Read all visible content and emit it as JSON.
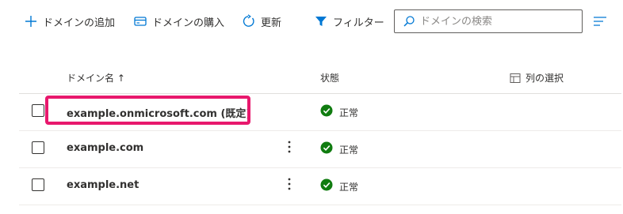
{
  "toolbar": {
    "add_domain": "ドメインの追加",
    "buy_domain": "ドメインの購入",
    "refresh": "更新",
    "filter": "フィルター"
  },
  "search": {
    "placeholder": "ドメインの検索",
    "value": ""
  },
  "table": {
    "columns": {
      "name": "ドメイン名 ↑",
      "status": "状態",
      "choose_columns": "列の選択"
    },
    "rows": [
      {
        "name": "example.onmicrosoft.com (既定)",
        "status": "正常",
        "has_more_menu": false
      },
      {
        "name": "example.com",
        "status": "正常",
        "has_more_menu": true
      },
      {
        "name": "example.net",
        "status": "正常",
        "has_more_menu": true
      }
    ]
  },
  "colors": {
    "accent": "#0078d4",
    "success": "#107c10",
    "highlight": "#e8186d"
  }
}
